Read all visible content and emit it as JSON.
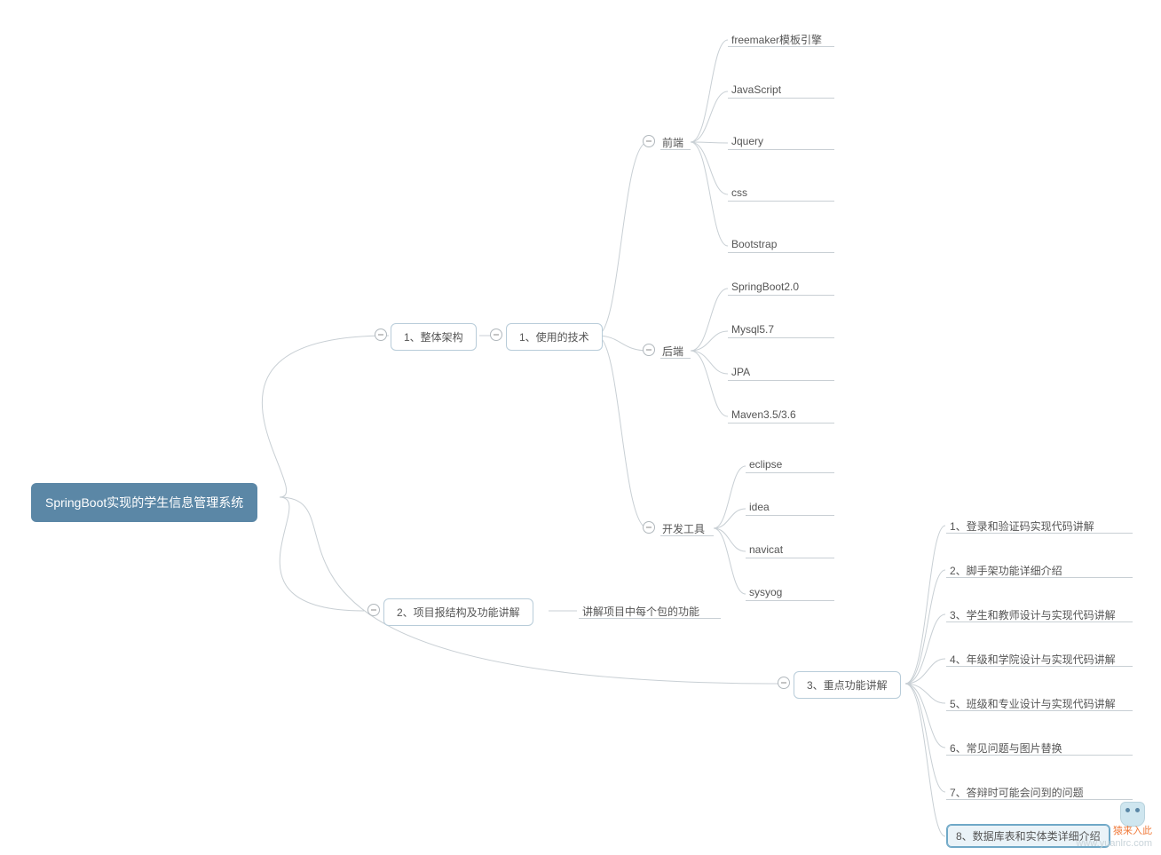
{
  "root": "SpringBoot实现的学生信息管理系统",
  "n1": {
    "title": "1、整体架构",
    "tech": "1、使用的技术"
  },
  "frontend": {
    "title": "前端",
    "items": [
      "freemaker模板引擎",
      "JavaScript",
      "Jquery",
      "css",
      "Bootstrap"
    ]
  },
  "backend": {
    "title": "后端",
    "items": [
      "SpringBoot2.0",
      "Mysql5.7",
      "JPA",
      "Maven3.5/3.6"
    ]
  },
  "devtool": {
    "title": "开发工具",
    "items": [
      "eclipse",
      "idea",
      "navicat",
      "sysyog"
    ]
  },
  "n2": {
    "title": "2、项目报结构及功能讲解",
    "desc": "讲解项目中每个包的功能"
  },
  "n3": {
    "title": "3、重点功能讲解",
    "items": [
      "1、登录和验证码实现代码讲解",
      "2、脚手架功能详细介绍",
      "3、学生和教师设计与实现代码讲解",
      "4、年级和学院设计与实现代码讲解",
      "5、班级和专业设计与实现代码讲解",
      "6、常见问题与图片替换",
      "7、答辩时可能会问到的问题",
      "8、数据库表和实体类详细介绍"
    ]
  },
  "watermark": {
    "line1": "猿来入此",
    "line2": "www.yuanlrc.com"
  }
}
